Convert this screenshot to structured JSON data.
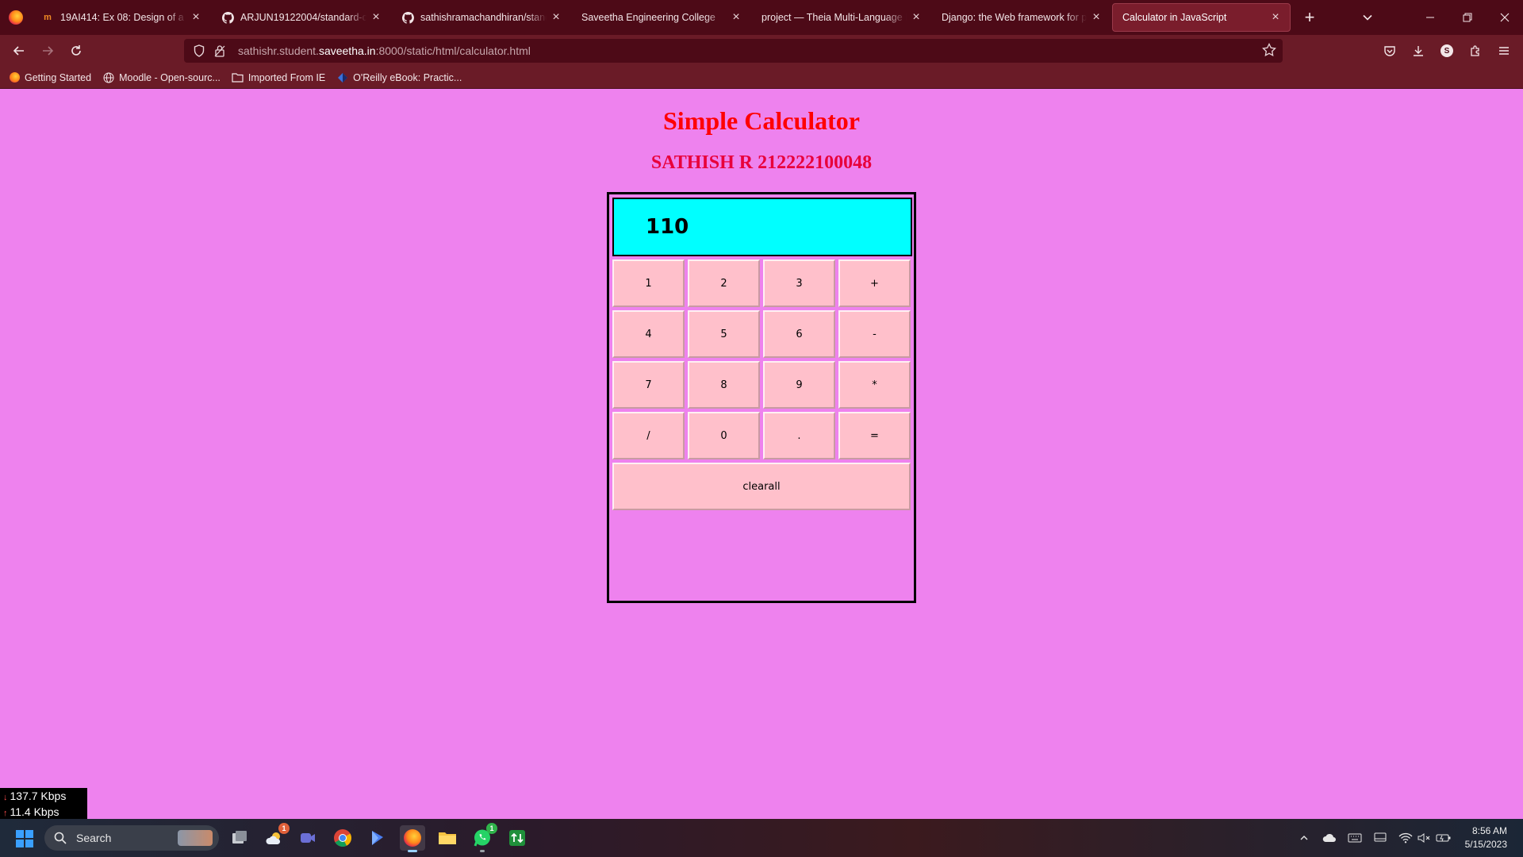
{
  "browser": {
    "tabs": [
      {
        "label": "19AI414: Ex 08: Design of a Stan",
        "icon": "moodle-icon",
        "active": false
      },
      {
        "label": "ARJUN19122004/standard-calcu",
        "icon": "github-icon",
        "active": false
      },
      {
        "label": "sathishramachandhiran/standar",
        "icon": "github-icon",
        "active": false
      },
      {
        "label": "Saveetha Engineering College",
        "icon": "",
        "active": false
      },
      {
        "label": "project — Theia Multi-Language Ex",
        "icon": "",
        "active": false
      },
      {
        "label": "Django: the Web framework for perf",
        "icon": "",
        "active": false
      },
      {
        "label": "Calculator in JavaScript",
        "icon": "",
        "active": true
      }
    ],
    "url_prefix": "sathishr.student.",
    "url_domain": "saveetha.in",
    "url_suffix": ":8000/static/html/calculator.html",
    "bookmarks": [
      {
        "label": "Getting Started",
        "icon": "firefox-icon"
      },
      {
        "label": "Moodle - Open-sourc...",
        "icon": "globe-icon"
      },
      {
        "label": "Imported From IE",
        "icon": "folder-icon"
      },
      {
        "label": "O'Reilly eBook: Practic...",
        "icon": "oreilly-icon"
      }
    ],
    "profile_initial": "S"
  },
  "page": {
    "title": "Simple Calculator",
    "subtitle": "SATHISH R 212222100048",
    "display_value": "110",
    "keys": [
      "1",
      "2",
      "3",
      "+",
      "4",
      "5",
      "6",
      "-",
      "7",
      "8",
      "9",
      "*",
      "/",
      "0",
      ".",
      "="
    ],
    "clear_label": "clearall"
  },
  "netmeter": {
    "down": "137.7 Kbps",
    "up": "11.4 Kbps"
  },
  "taskbar": {
    "search_label": "Search",
    "weather_badge": "1",
    "whatsapp_badge": "1",
    "time": "8:56 AM",
    "date": "5/15/2023"
  },
  "colors": {
    "page_bg": "#ee82ee",
    "display_bg": "#00ffff",
    "key_bg": "#ffc0cb",
    "heading": "#ff0000",
    "chrome": "#4d0a17"
  }
}
